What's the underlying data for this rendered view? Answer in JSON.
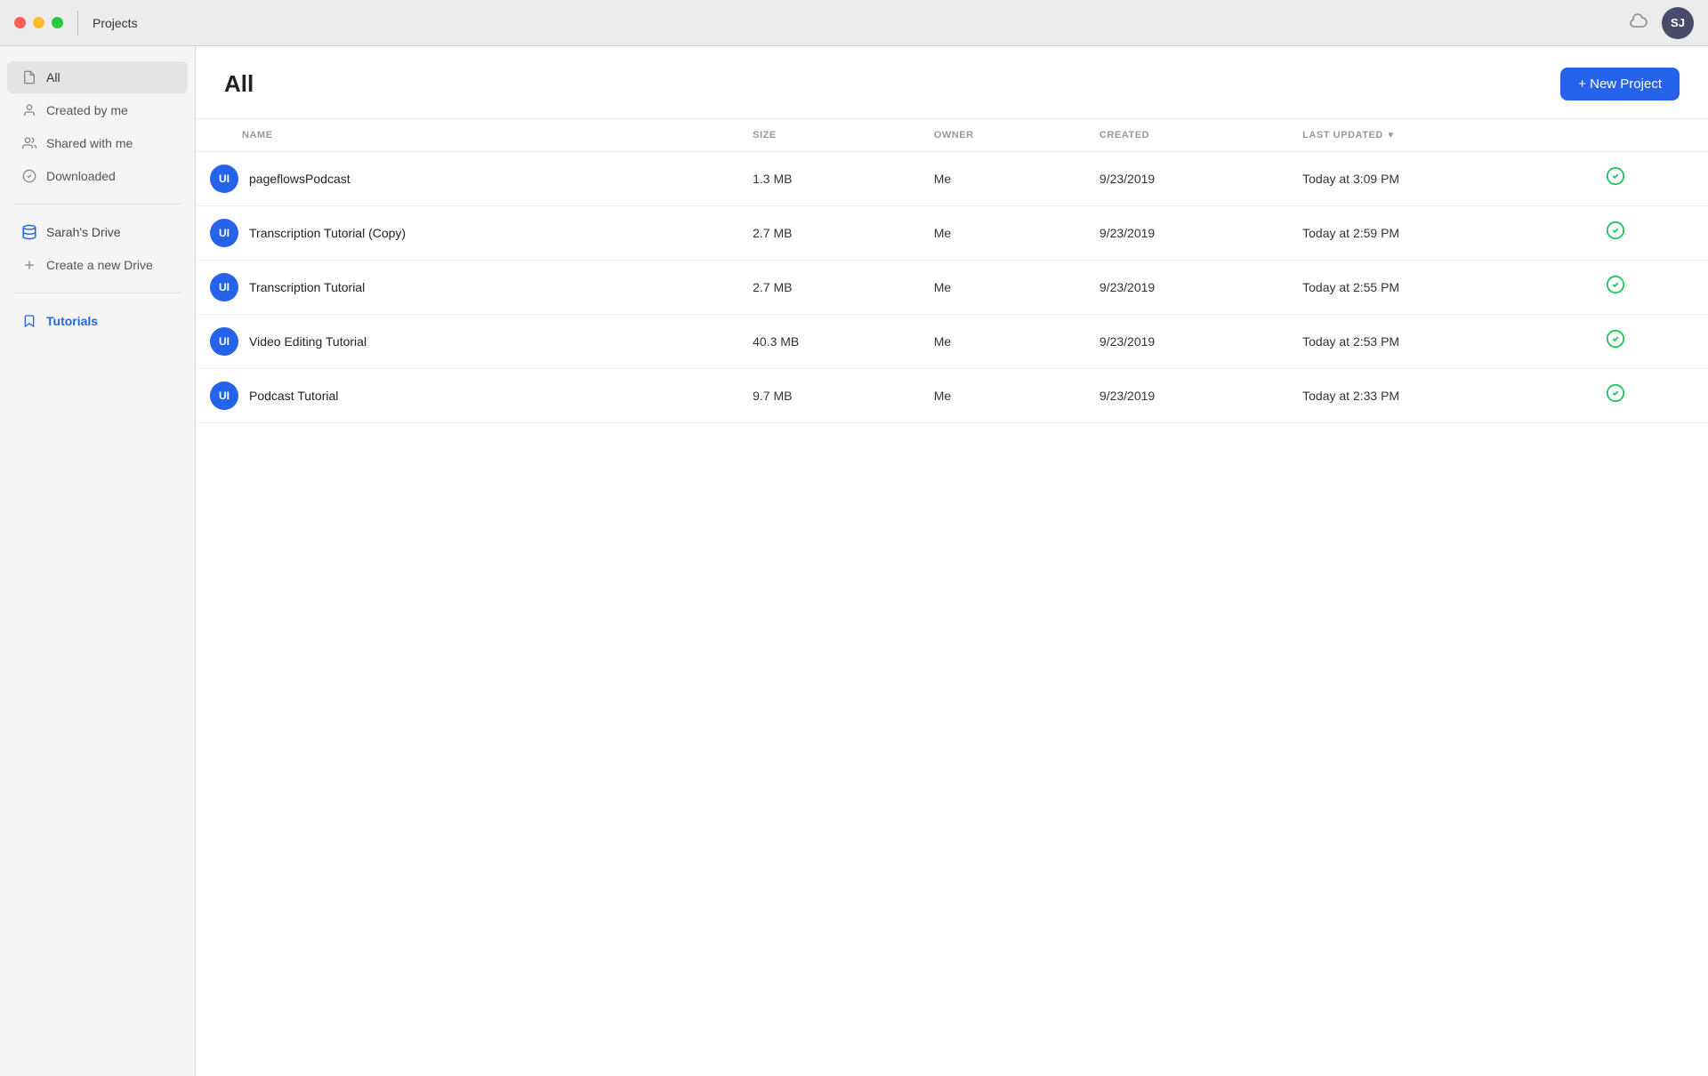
{
  "titlebar": {
    "title": "Projects",
    "avatar_initials": "SJ"
  },
  "sidebar": {
    "items_top": [
      {
        "id": "all",
        "label": "All",
        "icon": "file-icon",
        "active": true
      },
      {
        "id": "created-by-me",
        "label": "Created by me",
        "icon": "user-file-icon",
        "active": false
      },
      {
        "id": "shared-with-me",
        "label": "Shared with me",
        "icon": "shared-icon",
        "active": false
      },
      {
        "id": "downloaded",
        "label": "Downloaded",
        "icon": "check-circle-icon",
        "active": false
      }
    ],
    "drive_section": [
      {
        "id": "sarahs-drive",
        "label": "Sarah's Drive",
        "icon": "drive-icon"
      }
    ],
    "create_drive": {
      "label": "Create a new Drive",
      "icon": "plus-icon"
    },
    "pinned": [
      {
        "id": "tutorials",
        "label": "Tutorials",
        "icon": "bookmark-icon"
      }
    ]
  },
  "main": {
    "title": "All",
    "new_project_label": "+ New Project",
    "table": {
      "columns": [
        {
          "id": "name",
          "label": "NAME"
        },
        {
          "id": "size",
          "label": "SIZE"
        },
        {
          "id": "owner",
          "label": "OWNER"
        },
        {
          "id": "created",
          "label": "CREATED"
        },
        {
          "id": "last_updated",
          "label": "LAST UPDATED"
        }
      ],
      "rows": [
        {
          "id": 1,
          "icon_initials": "UI",
          "name": "pageflowsPodcast",
          "size": "1.3 MB",
          "owner": "Me",
          "created": "9/23/2019",
          "last_updated": "Today at 3:09 PM",
          "synced": true
        },
        {
          "id": 2,
          "icon_initials": "UI",
          "name": "Transcription Tutorial (Copy)",
          "size": "2.7 MB",
          "owner": "Me",
          "created": "9/23/2019",
          "last_updated": "Today at 2:59 PM",
          "synced": true
        },
        {
          "id": 3,
          "icon_initials": "UI",
          "name": "Transcription Tutorial",
          "size": "2.7 MB",
          "owner": "Me",
          "created": "9/23/2019",
          "last_updated": "Today at 2:55 PM",
          "synced": true
        },
        {
          "id": 4,
          "icon_initials": "UI",
          "name": "Video Editing Tutorial",
          "size": "40.3 MB",
          "owner": "Me",
          "created": "9/23/2019",
          "last_updated": "Today at 2:53 PM",
          "synced": true
        },
        {
          "id": 5,
          "icon_initials": "UI",
          "name": "Podcast Tutorial",
          "size": "9.7 MB",
          "owner": "Me",
          "created": "9/23/2019",
          "last_updated": "Today at 2:33 PM",
          "synced": true
        }
      ]
    }
  }
}
